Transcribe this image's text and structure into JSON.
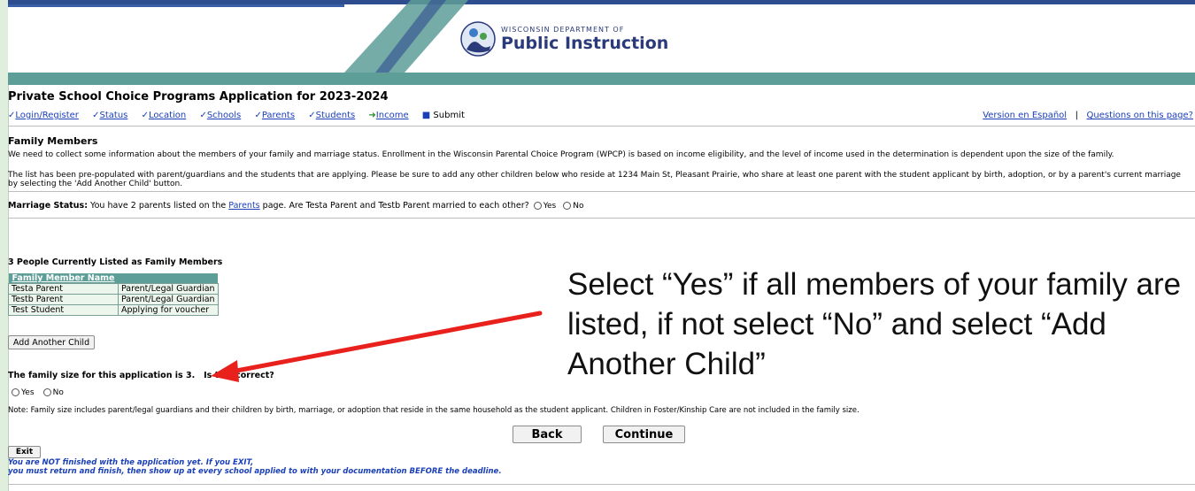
{
  "header": {
    "logo_small": "WISCONSIN DEPARTMENT OF",
    "logo_big": "Public Instruction",
    "logo_icon": "dpi-logo-icon"
  },
  "page_title": "Private School Choice Programs Application for 2023-2024",
  "steps": [
    {
      "label": "Login/Register",
      "state": "done"
    },
    {
      "label": "Status",
      "state": "done"
    },
    {
      "label": "Location",
      "state": "done"
    },
    {
      "label": "Schools",
      "state": "done"
    },
    {
      "label": "Parents",
      "state": "done"
    },
    {
      "label": "Students",
      "state": "done"
    },
    {
      "label": "Income",
      "state": "current"
    },
    {
      "label": "Submit",
      "state": "pending"
    }
  ],
  "top_links": {
    "spanish": "Version en Español",
    "separator": "|",
    "questions": "Questions on this page?"
  },
  "section_title": "Family Members",
  "paragraph1": "We need to collect some information about the members of your family and marriage status. Enrollment in the Wisconsin Parental Choice Program (WPCP) is based on income eligibility, and the level of income used in the determination is dependent upon the size of the family.",
  "paragraph2": "The list has been pre-populated with parent/guardians and the students that are applying. Please be sure to add any other children below who reside at 1234 Main St, Pleasant Prairie, who share at least one parent with the student applicant by birth, adoption, or by a parent's current marriage by selecting the 'Add Another Child' button.",
  "marriage": {
    "label": "Marriage Status:",
    "text_before": "You have 2 parents listed on the",
    "link": "Parents",
    "text_after": "page. Are Testa Parent and Testb Parent married to each other?",
    "yes": "Yes",
    "no": "No"
  },
  "family_list": {
    "heading": "3 People Currently Listed as Family Members",
    "column_header": "Family Member Name",
    "rows": [
      {
        "name": "Testa Parent",
        "role": "Parent/Legal Guardian"
      },
      {
        "name": "Testb Parent",
        "role": "Parent/Legal Guardian"
      },
      {
        "name": "Test Student",
        "role": "Applying for voucher"
      }
    ],
    "add_button": "Add Another Child"
  },
  "family_size": {
    "question": "The family size for this application is 3.   Is this correct?",
    "yes": "Yes",
    "no": "No"
  },
  "note": "Note: Family size includes parent/legal guardians and their children by birth, marriage, or adoption that reside in the same household as the student applicant. Children in Foster/Kinship Care are not included in the family size.",
  "buttons": {
    "back": "Back",
    "continue": "Continue",
    "exit": "Exit"
  },
  "warning_line1": "You are NOT finished with the application yet. If you EXIT,",
  "warning_line2": "you must return and finish, then show up at every school applied to with your documentation BEFORE the deadline.",
  "callout": "Select “Yes” if all members of your family are listed, if not select “No” and select “Add Another Child”",
  "colors": {
    "header_band": "#5e9e98",
    "header_top": "#2e4d8f",
    "link": "#1a3fb8",
    "arrow": "#e8211d"
  }
}
